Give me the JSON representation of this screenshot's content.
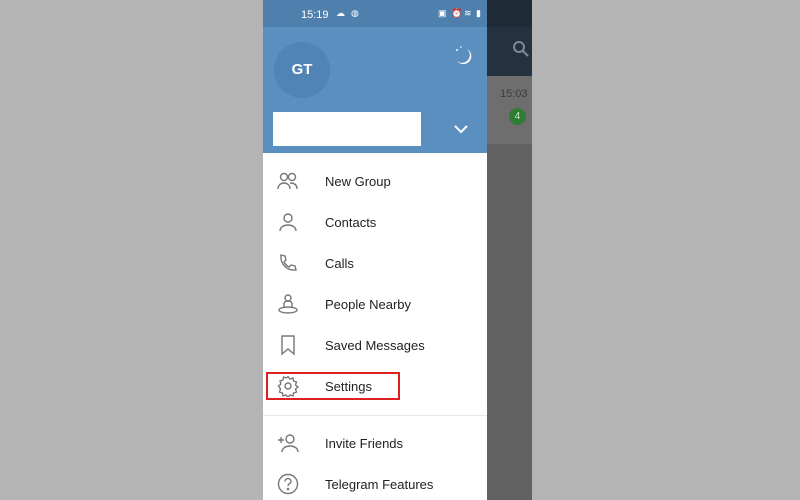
{
  "statusbar": {
    "time": "15:19",
    "battery": "98"
  },
  "header": {
    "avatar_initials": "GT",
    "account_name": ""
  },
  "menu": {
    "items": [
      {
        "label": "New Group",
        "icon": "group-icon"
      },
      {
        "label": "Contacts",
        "icon": "person-icon"
      },
      {
        "label": "Calls",
        "icon": "phone-icon"
      },
      {
        "label": "People Nearby",
        "icon": "people-nearby-icon"
      },
      {
        "label": "Saved Messages",
        "icon": "bookmark-icon"
      },
      {
        "label": "Settings",
        "icon": "gear-icon"
      }
    ],
    "secondary": [
      {
        "label": "Invite Friends",
        "icon": "add-person-icon"
      },
      {
        "label": "Telegram Features",
        "icon": "question-icon"
      }
    ]
  },
  "background_chat": {
    "time": "15:03",
    "unread": "4"
  },
  "colors": {
    "header": "#5b8fbf",
    "highlight": "#e02020",
    "badge": "#2e7d32"
  }
}
